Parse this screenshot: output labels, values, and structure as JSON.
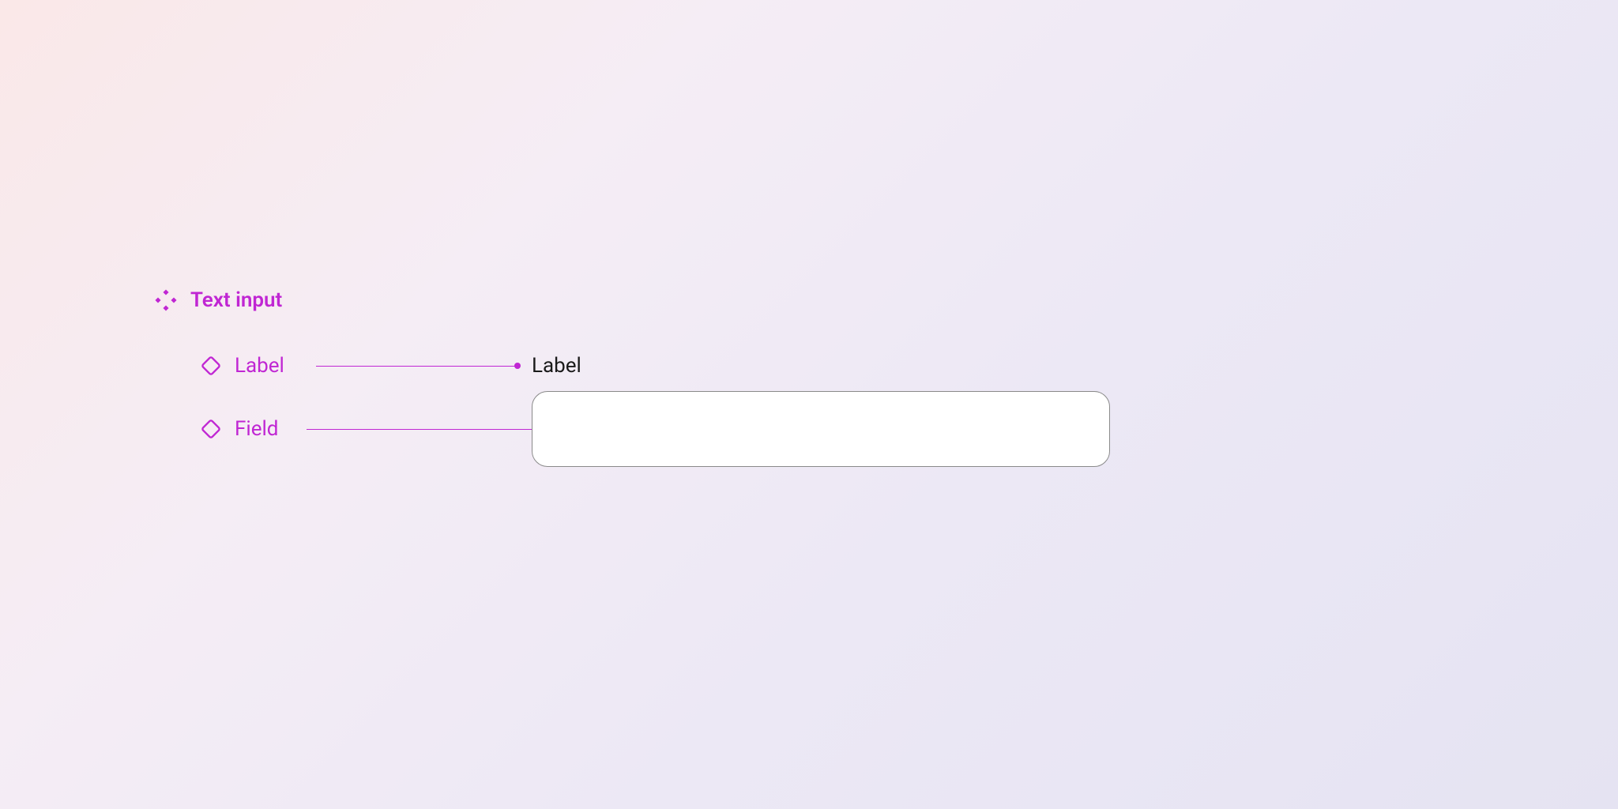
{
  "component": {
    "title": "Text input"
  },
  "annotations": {
    "label_text": "Label",
    "field_text": "Field"
  },
  "preview": {
    "label": "Label"
  },
  "colors": {
    "accent": "#c026d3",
    "text": "#1a1a1a",
    "field_border": "#8a8a8a",
    "field_bg": "#ffffff"
  }
}
